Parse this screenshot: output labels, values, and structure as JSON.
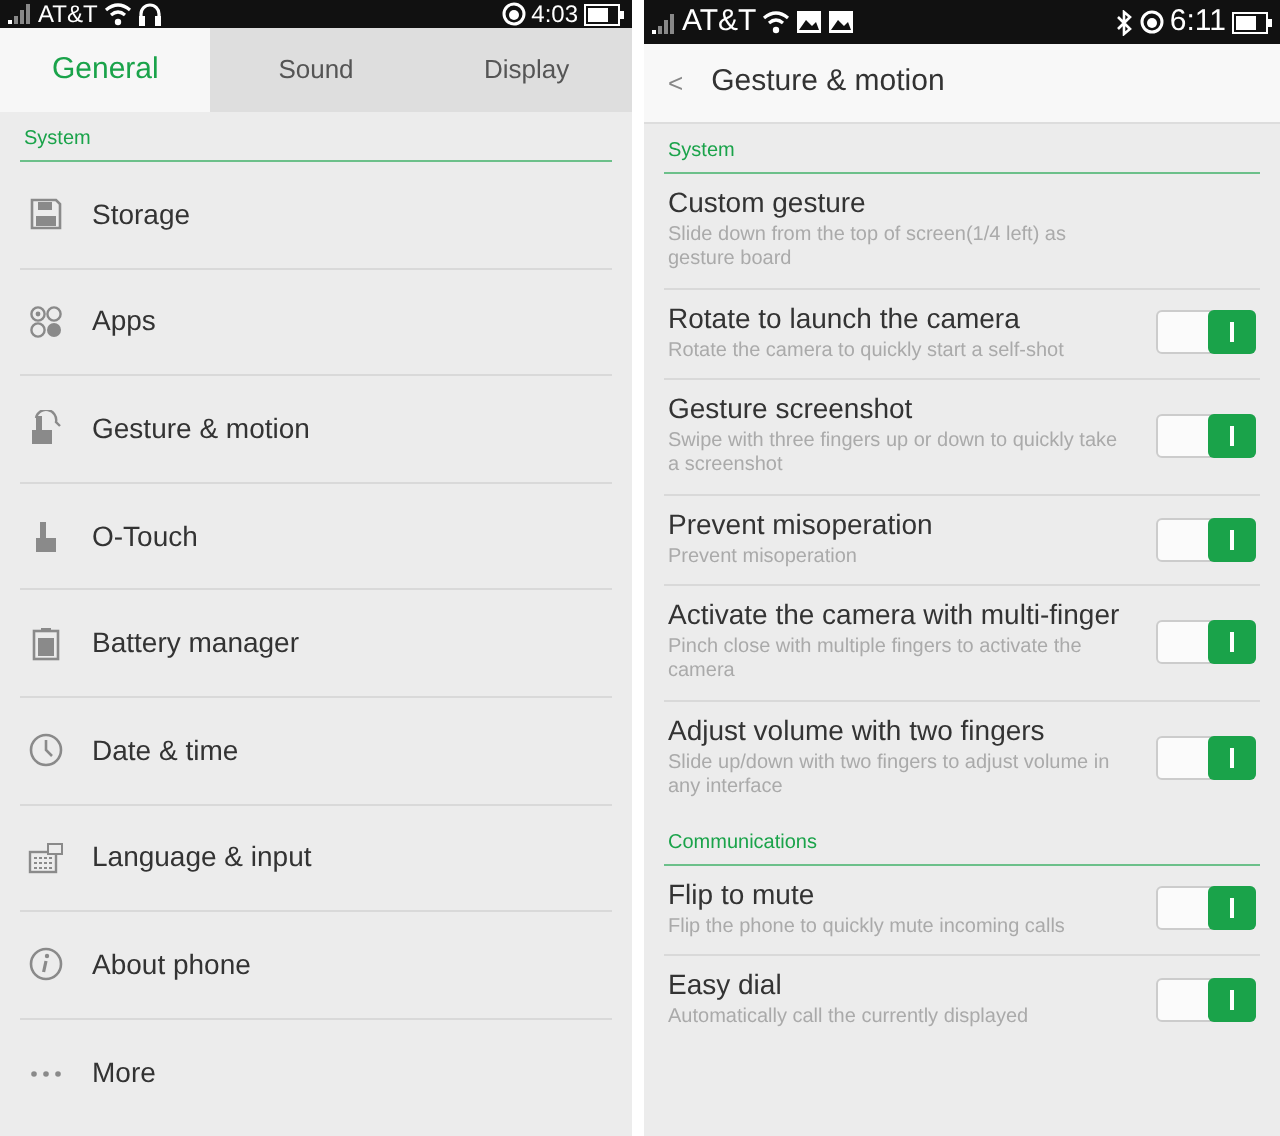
{
  "left_screen": {
    "status_bar": {
      "carrier": "AT&T",
      "time": "4:03"
    },
    "tabs": [
      {
        "label": "General",
        "selected": true
      },
      {
        "label": "Sound",
        "selected": false
      },
      {
        "label": "Display",
        "selected": false
      }
    ],
    "section": "System",
    "items": [
      {
        "label": "Storage"
      },
      {
        "label": "Apps"
      },
      {
        "label": "Gesture & motion"
      },
      {
        "label": "O-Touch"
      },
      {
        "label": "Battery manager"
      },
      {
        "label": "Date & time"
      },
      {
        "label": "Language & input"
      },
      {
        "label": "About phone"
      },
      {
        "label": "More"
      }
    ]
  },
  "right_screen": {
    "status_bar": {
      "carrier": "AT&T",
      "time": "6:11"
    },
    "header": {
      "back": "<",
      "title": "Gesture & motion"
    },
    "sections": [
      {
        "title": "System",
        "rows": [
          {
            "title": "Custom gesture",
            "subtitle": "Slide down from the top of screen(1/4 left) as gesture board",
            "kind": "plain"
          },
          {
            "title": "Rotate to launch the camera",
            "subtitle": "Rotate the camera to quickly start a self-shot",
            "kind": "toggle",
            "on": true
          },
          {
            "title": "Gesture screenshot",
            "subtitle": "Swipe with three fingers up or down to quickly take a screenshot",
            "kind": "toggle",
            "on": true
          },
          {
            "title": "Prevent misoperation",
            "subtitle": "Prevent misoperation",
            "kind": "toggle",
            "on": true
          },
          {
            "title": "Activate the camera with multi-finger",
            "subtitle": "Pinch close with multiple fingers to activate the camera",
            "kind": "toggle",
            "on": true
          },
          {
            "title": "Adjust volume with two fingers",
            "subtitle": "Slide up/down with two fingers to adjust volume in any interface",
            "kind": "toggle",
            "on": true
          }
        ]
      },
      {
        "title": "Communications",
        "rows": [
          {
            "title": "Flip to mute",
            "subtitle": "Flip the phone to quickly mute incoming calls",
            "kind": "toggle",
            "on": true
          },
          {
            "title": "Easy dial",
            "subtitle": "Automatically call the currently displayed",
            "kind": "toggle",
            "on": true
          }
        ]
      }
    ]
  }
}
